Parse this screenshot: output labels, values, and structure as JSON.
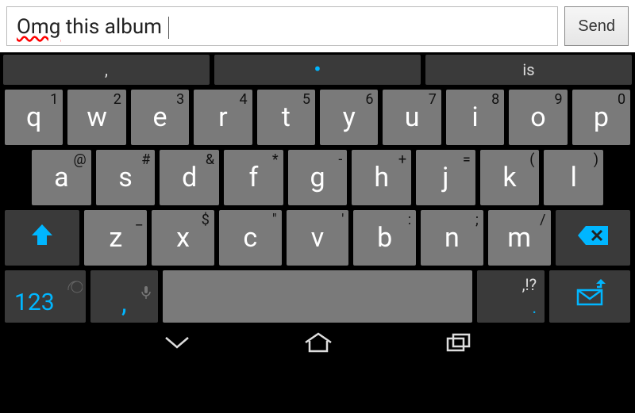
{
  "input": {
    "text_prefix_spellcheck": "Omg",
    "text_rest": " this album ",
    "placeholder": ""
  },
  "send_label": "Send",
  "suggestions": {
    "left": ",",
    "mid_is_dot": true,
    "right": "is"
  },
  "rows": {
    "r1": [
      {
        "main": "q",
        "sub": "1"
      },
      {
        "main": "w",
        "sub": "2"
      },
      {
        "main": "e",
        "sub": "3"
      },
      {
        "main": "r",
        "sub": "4"
      },
      {
        "main": "t",
        "sub": "5"
      },
      {
        "main": "y",
        "sub": "6"
      },
      {
        "main": "u",
        "sub": "7"
      },
      {
        "main": "i",
        "sub": "8"
      },
      {
        "main": "o",
        "sub": "9"
      },
      {
        "main": "p",
        "sub": "0"
      }
    ],
    "r2": [
      {
        "main": "a",
        "sub": "@"
      },
      {
        "main": "s",
        "sub": "#"
      },
      {
        "main": "d",
        "sub": "&"
      },
      {
        "main": "f",
        "sub": "*"
      },
      {
        "main": "g",
        "sub": "-"
      },
      {
        "main": "h",
        "sub": "+"
      },
      {
        "main": "j",
        "sub": "="
      },
      {
        "main": "k",
        "sub": "("
      },
      {
        "main": "l",
        "sub": ")"
      }
    ],
    "r3_letters": [
      {
        "main": "z",
        "sub": "_"
      },
      {
        "main": "x",
        "sub": "$"
      },
      {
        "main": "c",
        "sub": "\""
      },
      {
        "main": "v",
        "sub": "'"
      },
      {
        "main": "b",
        "sub": ":"
      },
      {
        "main": "n",
        "sub": ";"
      },
      {
        "main": "m",
        "sub": "/"
      }
    ],
    "r4": {
      "numkey": "123",
      "comma": ",",
      "punct_label": ",!?",
      "punct_sub": "."
    }
  }
}
